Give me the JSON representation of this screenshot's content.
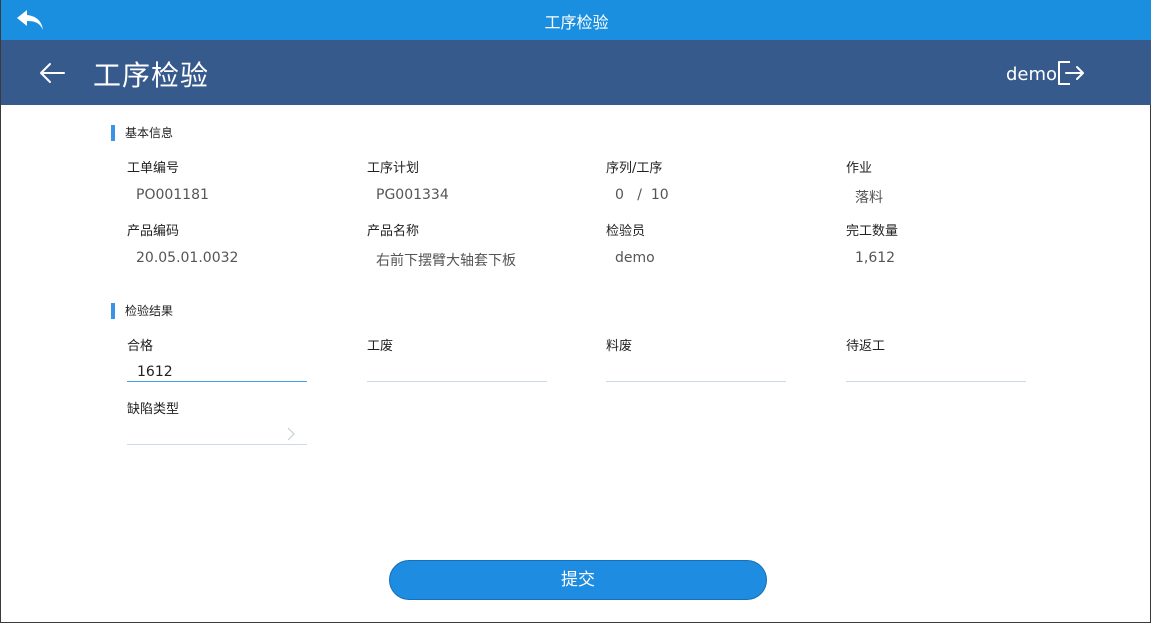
{
  "window": {
    "title": "工序检验"
  },
  "header": {
    "title": "工序检验",
    "user": "demo"
  },
  "basic_info": {
    "section_title": "基本信息",
    "fields": [
      {
        "label": "工单编号",
        "value": "PO001181"
      },
      {
        "label": "工序计划",
        "value": "PG001334"
      },
      {
        "label": "序列/工序",
        "value": "0   /  10"
      },
      {
        "label": "作业",
        "value": "落料"
      },
      {
        "label": "产品编码",
        "value": "20.05.01.0032"
      },
      {
        "label": "产品名称",
        "value": "右前下摆臂大轴套下板"
      },
      {
        "label": "检验员",
        "value": "demo"
      },
      {
        "label": "完工数量",
        "value": "1,612"
      }
    ]
  },
  "inspection": {
    "section_title": "检验结果",
    "inputs": [
      {
        "label": "合格",
        "value": "1612"
      },
      {
        "label": "工废",
        "value": ""
      },
      {
        "label": "料废",
        "value": ""
      },
      {
        "label": "待返工",
        "value": ""
      }
    ],
    "defect_type": {
      "label": "缺陷类型",
      "value": ""
    }
  },
  "actions": {
    "submit_label": "提交"
  },
  "colors": {
    "topbar": "#1a8fe0",
    "header": "#375a8c",
    "accent": "#3a93e6",
    "button": "#1e8ce0"
  }
}
